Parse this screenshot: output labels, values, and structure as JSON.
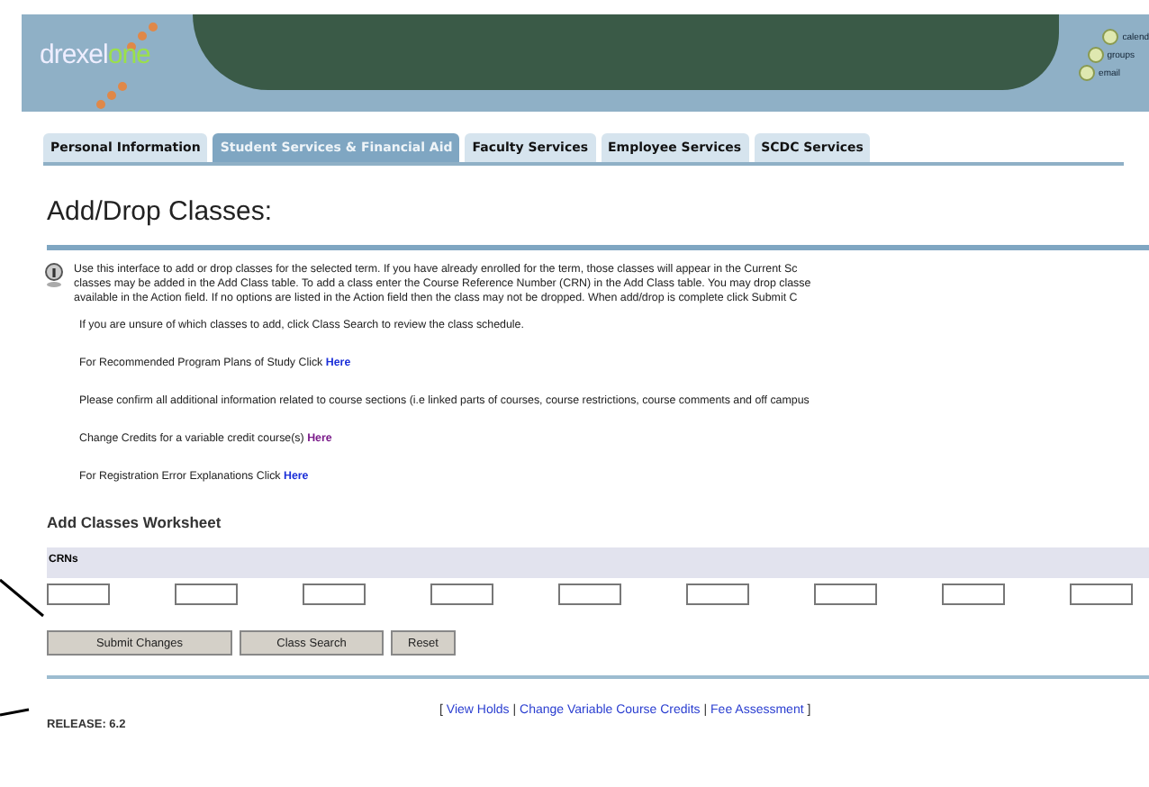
{
  "header": {
    "logo_prefix": "drexel",
    "logo_suffix": "one",
    "links": [
      {
        "label": "calend"
      },
      {
        "label": "groups"
      },
      {
        "label": "email"
      }
    ]
  },
  "tabs": [
    {
      "label": "Personal Information",
      "selected": false
    },
    {
      "label": "Student Services & Financial Aid",
      "selected": true
    },
    {
      "label": "Faculty Services",
      "selected": false
    },
    {
      "label": "Employee Services",
      "selected": false
    },
    {
      "label": "SCDC Services",
      "selected": false
    }
  ],
  "title": "Add/Drop Classes:",
  "info": [
    "Use this interface to add or drop classes for the selected term. If you have already enrolled for the term, those classes will appear in the Current Sc",
    "classes may be added in the Add Class table. To add a class enter the Course Reference Number (CRN) in the Add Class table. You may drop classe",
    "available in the Action field. If no options are listed in the Action field then the class may not be dropped. When add/drop is complete click Submit C"
  ],
  "notes": [
    {
      "text": "If you are unsure of which classes to add, click Class Search to review the class schedule."
    },
    {
      "text": "For Recommended Program Plans of Study Click ",
      "link": "Here",
      "visited": false
    },
    {
      "text": "Please confirm all additional information related to course sections (i.e linked parts of courses, course restrictions, course comments and off campus"
    },
    {
      "text": "Change Credits for a variable credit course(s) ",
      "link": "Here",
      "visited": true
    },
    {
      "text": "For Registration Error Explanations Click ",
      "link": "Here",
      "visited": false
    }
  ],
  "worksheet": {
    "title": "Add Classes Worksheet",
    "column": "CRNs",
    "buttons": [
      "Submit Changes",
      "Class Search",
      "Reset"
    ]
  },
  "footer": [
    {
      "kind": "bracket",
      "text": "["
    },
    {
      "kind": "link",
      "text": "View Holds"
    },
    {
      "kind": "separator",
      "text": "|"
    },
    {
      "kind": "link",
      "text": "Change Variable Course Credits"
    },
    {
      "kind": "separator",
      "text": "|"
    },
    {
      "kind": "link",
      "text": "Fee Assessment"
    },
    {
      "kind": "bracket",
      "text": "]"
    }
  ],
  "release": "RELEASE: 6.2"
}
